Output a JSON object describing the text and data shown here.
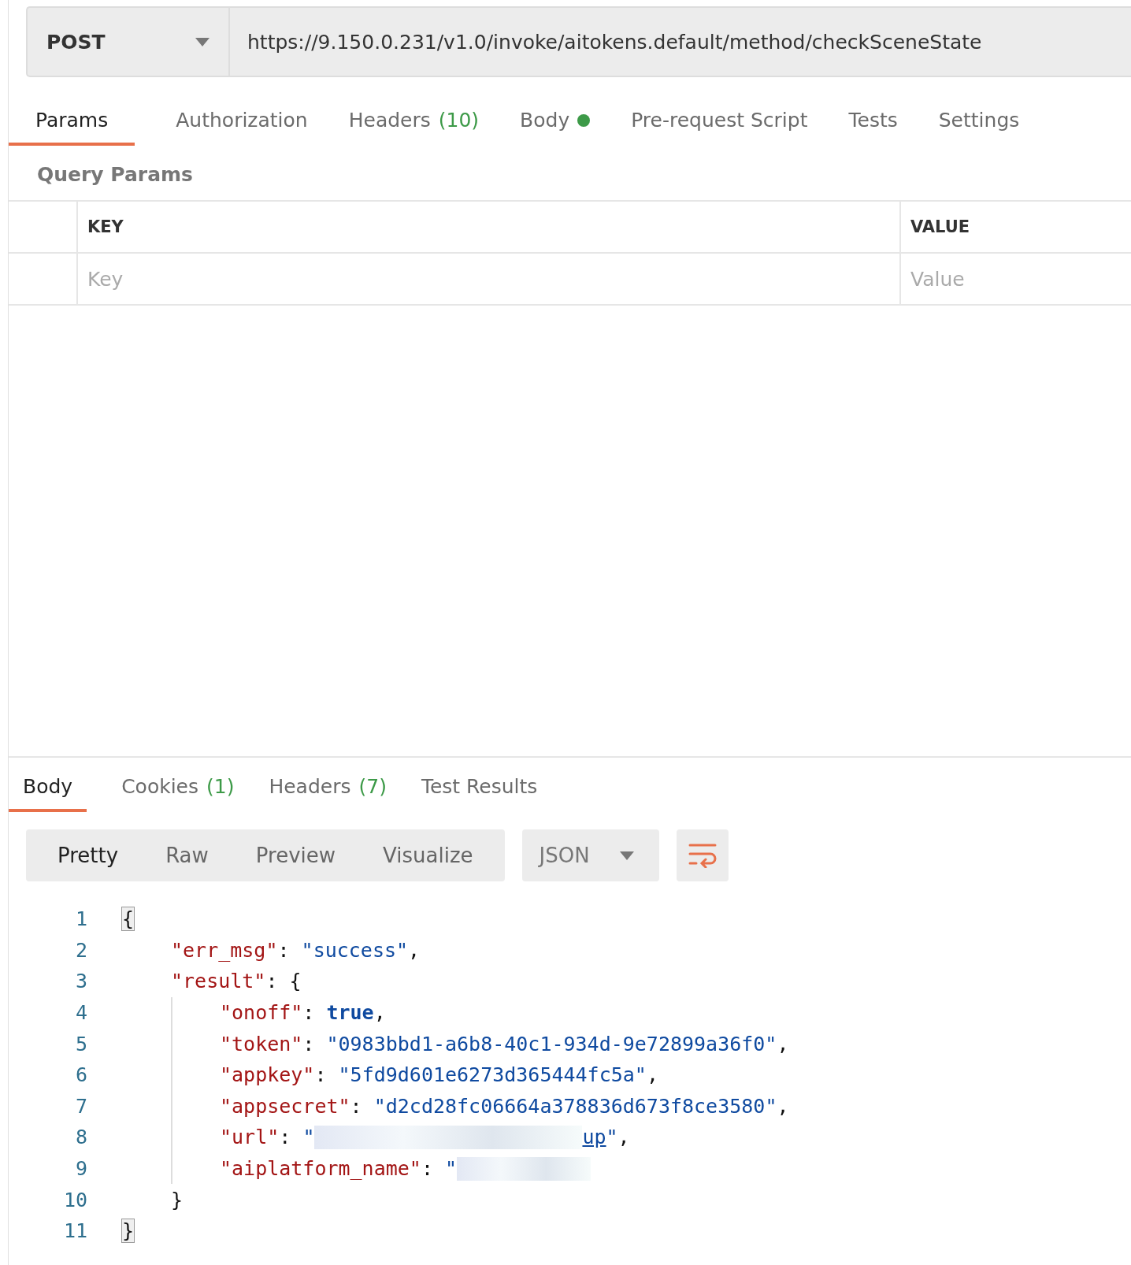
{
  "request": {
    "method": "POST",
    "url": "https://9.150.0.231/v1.0/invoke/aitokens.default/method/checkSceneState"
  },
  "request_tabs": [
    {
      "label": "Params",
      "selected": true
    },
    {
      "label": "Authorization",
      "selected": false
    },
    {
      "label": "Headers",
      "count": "(10)",
      "selected": false
    },
    {
      "label": "Body",
      "color": "#3d9a48",
      "selected": false
    },
    {
      "label": "Pre-request Script",
      "selected": false
    },
    {
      "label": "Tests",
      "selected": false
    },
    {
      "label": "Settings",
      "selected": false
    }
  ],
  "query_params": {
    "title": "Query Params",
    "columns": [
      "KEY",
      "VALUE"
    ],
    "placeholders": [
      "Key",
      "Value"
    ]
  },
  "response_tabs": [
    {
      "label": "Body",
      "selected": true
    },
    {
      "label": "Cookies",
      "count": "(1)",
      "selected": false
    },
    {
      "label": "Headers",
      "count": "(7)",
      "selected": false
    },
    {
      "label": "Test Results",
      "selected": false
    }
  ],
  "view_modes": [
    {
      "label": "Pretty",
      "selected": true
    },
    {
      "label": "Raw",
      "selected": false
    },
    {
      "label": "Preview",
      "selected": false
    },
    {
      "label": "Visualize",
      "selected": false
    }
  ],
  "format": "JSON",
  "code_lines": [
    {
      "number": "1",
      "tokens": [
        {
          "kind": "bracket",
          "text": "{"
        }
      ],
      "children": [
        {
          "number": "2",
          "tokens": [
            {
              "kind": "key",
              "text": "\"err_msg\""
            },
            {
              "kind": "punct",
              "text": ": "
            },
            {
              "kind": "string",
              "text": "\"success\""
            },
            {
              "kind": "punct",
              "text": ","
            }
          ]
        },
        {
          "number": "3",
          "tokens": [
            {
              "kind": "key",
              "text": "\"result\""
            },
            {
              "kind": "punct",
              "text": ": {"
            }
          ],
          "children": [
            {
              "number": "4",
              "tokens": [
                {
                  "kind": "key",
                  "text": "\"onoff\""
                },
                {
                  "kind": "punct",
                  "text": ": "
                },
                {
                  "kind": "bool",
                  "text": "true"
                },
                {
                  "kind": "punct",
                  "text": ","
                }
              ]
            },
            {
              "number": "5",
              "tokens": [
                {
                  "kind": "key",
                  "text": "\"token\""
                },
                {
                  "kind": "punct",
                  "text": ": "
                },
                {
                  "kind": "string",
                  "text": "\"0983bbd1-a6b8-40c1-934d-9e72899a36f0\""
                },
                {
                  "kind": "punct",
                  "text": ","
                }
              ]
            },
            {
              "number": "6",
              "tokens": [
                {
                  "kind": "key",
                  "text": "\"appkey\""
                },
                {
                  "kind": "punct",
                  "text": ": "
                },
                {
                  "kind": "string",
                  "text": "\"5fd9d601e6273d365444fc5a\""
                },
                {
                  "kind": "punct",
                  "text": ","
                }
              ]
            },
            {
              "number": "7",
              "tokens": [
                {
                  "kind": "key",
                  "text": "\"appsecret\""
                },
                {
                  "kind": "punct",
                  "text": ": "
                },
                {
                  "kind": "string",
                  "text": "\"d2cd28fc06664a378836d673f8ce3580\""
                },
                {
                  "kind": "punct",
                  "text": ","
                }
              ]
            },
            {
              "number": "8",
              "tokens": [
                {
                  "kind": "key",
                  "text": "\"url\""
                },
                {
                  "kind": "punct",
                  "text": ": "
                },
                {
                  "kind": "string",
                  "text": "\""
                },
                {
                  "kind": "redacted"
                },
                {
                  "kind": "link",
                  "text": "up"
                },
                {
                  "kind": "string",
                  "text": "\""
                },
                {
                  "kind": "punct",
                  "text": ","
                }
              ]
            },
            {
              "number": "9",
              "tokens": [
                {
                  "kind": "key",
                  "text": "\"aiplatform_name\""
                },
                {
                  "kind": "punct",
                  "text": ": "
                },
                {
                  "kind": "string",
                  "text": "\""
                },
                {
                  "kind": "redacted"
                }
              ]
            }
          ]
        },
        {
          "number": "10",
          "tokens": [
            {
              "kind": "punct",
              "text": "}"
            }
          ]
        }
      ]
    },
    {
      "number": "11",
      "tokens": [
        {
          "kind": "bracket",
          "text": "}"
        }
      ]
    }
  ]
}
